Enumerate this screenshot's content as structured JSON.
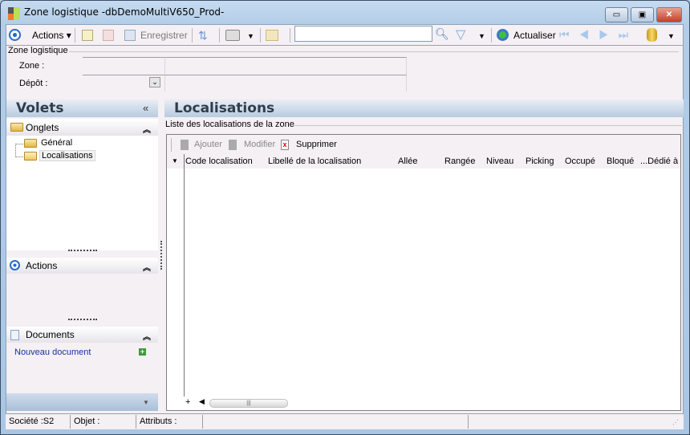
{
  "window": {
    "title": "Zone logistique -dbDemoMultiV650_Prod-",
    "minimize": "▭",
    "restore": "▣",
    "close": "✕"
  },
  "toolbar": {
    "actions": "Actions",
    "save": "Enregistrer",
    "search_value": "",
    "refresh": "Actualiser"
  },
  "zone_group": {
    "legend": "Zone logistique",
    "zone_label": "Zone :",
    "zone_value": "",
    "depot_label": "Dépôt :",
    "depot_value": ""
  },
  "left": {
    "title": "Volets",
    "collapse": "«",
    "onglets": "Onglets",
    "tree": [
      {
        "label": "Général"
      },
      {
        "label": "Localisations"
      }
    ],
    "actions": "Actions",
    "documents": "Documents",
    "new_document": "Nouveau document",
    "chevron_up": "⌃"
  },
  "main": {
    "title": "Localisations",
    "group_legend": "Liste des localisations de la zone",
    "add": "Ajouter",
    "edit": "Modifier",
    "delete": "Supprimer",
    "columns": [
      "Code localisation",
      "Libellé de la localisation",
      "Allée",
      "Rangée",
      "Niveau",
      "Picking",
      "Occupé",
      "Bloqué",
      "...Dédié à"
    ],
    "rows": []
  },
  "status": {
    "societe": "Société :S2",
    "objet": "Objet :",
    "attributs": "Attributs :"
  }
}
